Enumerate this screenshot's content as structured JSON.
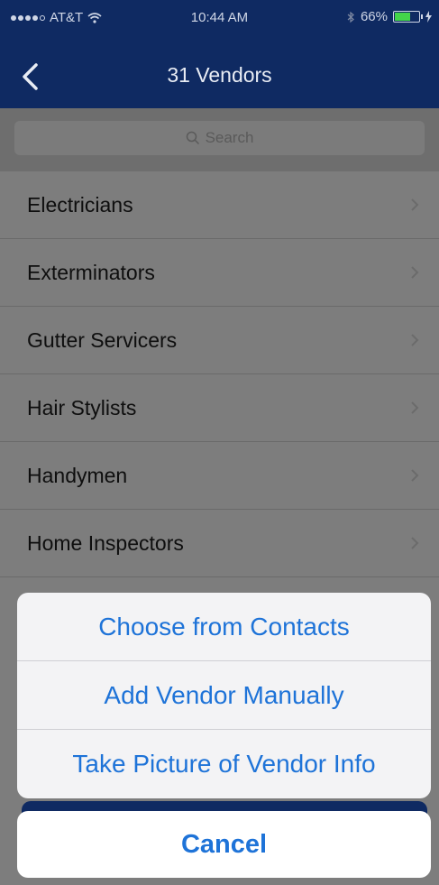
{
  "status_bar": {
    "carrier": "AT&T",
    "time": "10:44 AM",
    "battery": "66%",
    "battery_level": 0.66
  },
  "nav": {
    "title": "31 Vendors"
  },
  "search": {
    "placeholder": "Search"
  },
  "categories": [
    {
      "label": "Electricians"
    },
    {
      "label": "Exterminators"
    },
    {
      "label": "Gutter Servicers"
    },
    {
      "label": "Hair Stylists"
    },
    {
      "label": "Handymen"
    },
    {
      "label": "Home Inspectors"
    }
  ],
  "action_sheet": {
    "options": [
      {
        "label": "Choose from Contacts"
      },
      {
        "label": "Add Vendor Manually"
      },
      {
        "label": "Take Picture of Vendor Info"
      }
    ],
    "cancel_label": "Cancel"
  },
  "colors": {
    "nav_bar": "#0f2a62",
    "accent": "#1e73d8",
    "battery": "#43d44a"
  }
}
